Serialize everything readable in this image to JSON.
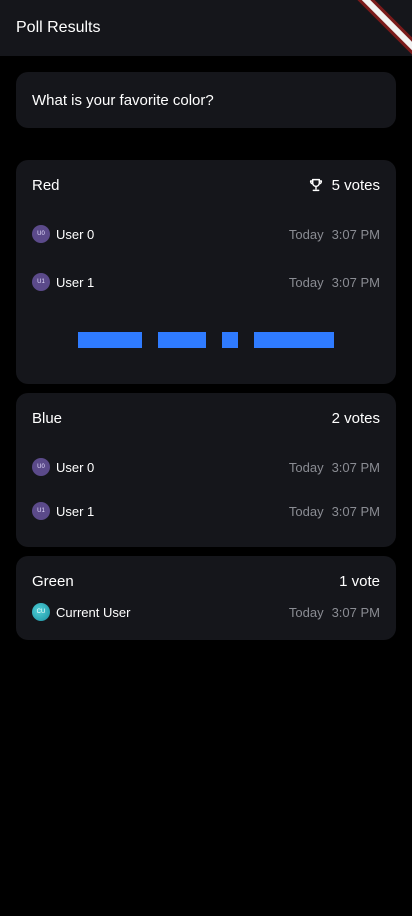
{
  "appbar": {
    "title": "Poll Results"
  },
  "question": {
    "text": "What is your favorite color?"
  },
  "options": [
    {
      "name": "Red",
      "votes_label": "5 votes",
      "winner": true,
      "voters": [
        {
          "initials": "U0",
          "name": "User 0",
          "day": "Today",
          "time": "3:07 PM"
        },
        {
          "initials": "U1",
          "name": "User 1",
          "day": "Today",
          "time": "3:07 PM"
        }
      ]
    },
    {
      "name": "Blue",
      "votes_label": "2 votes",
      "voters": [
        {
          "initials": "U0",
          "name": "User 0",
          "day": "Today",
          "time": "3:07 PM"
        },
        {
          "initials": "U1",
          "name": "User 1",
          "day": "Today",
          "time": "3:07 PM"
        }
      ]
    },
    {
      "name": "Green",
      "votes_label": "1 vote",
      "voters": [
        {
          "initials": "CU",
          "name": "Current User",
          "day": "Today",
          "time": "3:07 PM"
        }
      ]
    }
  ],
  "colors": {
    "background": "#000000",
    "card": "#15161b",
    "accent_bar": "#2f7bff",
    "muted_text": "#8a8c93",
    "avatar": "#5b4a8a"
  }
}
